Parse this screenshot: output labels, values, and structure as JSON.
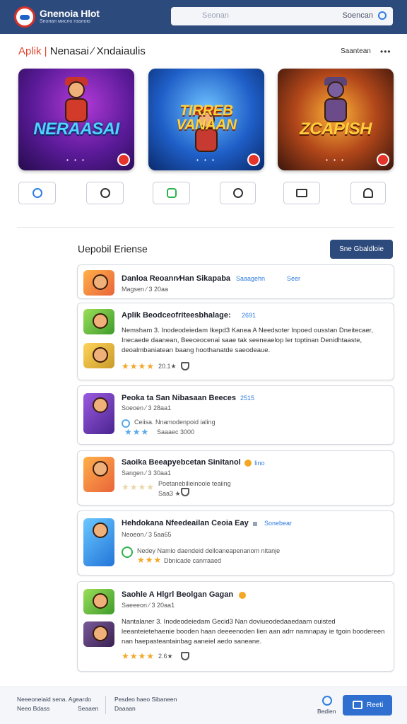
{
  "header": {
    "logo_text": "Gnenoia Hlot",
    "logo_sub": "Ѕнонан мисло гоалою",
    "search_placeholder": "Seonan",
    "search_label": "Soencan"
  },
  "featured": {
    "title_highlight": "Aplik |",
    "title_rest": " Nenasai ⁄ Xndaiaulis",
    "link": "Saantean",
    "games": [
      {
        "title": "NERAASAI",
        "dots": "• • •"
      },
      {
        "title": "TIRREB VANAAN",
        "dots": "• • •"
      },
      {
        "title": "ZCAPISH",
        "dots": "• • •"
      }
    ]
  },
  "list": {
    "title": "Uepobil Eriense",
    "see_all": "Sne Gbaldloie",
    "items": [
      {
        "title": "Danloa Reoann⁄Han Sikapaba",
        "tag": "Saaagehn",
        "tag2": "Seer",
        "sub": "Magsen ⁄ 3 20aa"
      },
      {
        "title": "Aplik Beodceofriteesbhalage:",
        "tag": "2691",
        "desc": "Nemsham 3. Inodeodeiedam Ikepd3 Kanea A Needsoter Inpoed ousstan Dneitecaer, Inecaede daanean, Beeceocenai saae tak seeneaelop ler toptinan Denidhtaaste, deoalmbaniatearı baang hoothanatde saeodeaue.",
        "rating": "20.1★"
      },
      {
        "title": "Peoka ta San Nibasaan Beeces",
        "tag": "2515",
        "sub": "Soeoen ⁄ 3 28aa1",
        "meta1": "Ceiisa. Nnamodenpoid ialing",
        "meta2": "Saaaec 3000"
      },
      {
        "title": "Saoika Beeapyebcetan Sinitanol",
        "tag": "Iino",
        "sub": "Sangen ⁄ 3 30aa1",
        "meta1": "Poetanebilieinoole teaiing",
        "meta2": "Saa3 ★"
      },
      {
        "title": "Hehdokana Nfeedeailan Ceoia Eay",
        "tag": "Sonebear",
        "sub": "Neoeon ⁄ 3 5aa65",
        "meta1": "Nedey Namio daendeid delloaneapenanom nitanje",
        "meta2": "Dbnicade canrraaed"
      },
      {
        "title": "Saohle A Hlgrl Beolgan Gagan",
        "sub": "Saeeeon ⁄ 3 20aa1",
        "desc": "Nantalaner 3. Inodeodeiedam Gecid3 Nan doviueodedaaedaam ouisted leeanteietehaenie booden haan deeeenoden lien aan adrr namnapay ie tgoin boodereen nan haepasteantainbag aaneiel aedo saneane.",
        "rating": "2.6★"
      }
    ]
  },
  "footer": {
    "col1_line1": "Neeeoneiaid sena. Ageardo",
    "col1_line2": "Neeo Bdass",
    "col1_line2b": "Seaaen",
    "col2_line1": "Pesdeo haeo Sibaneen",
    "col2_line2": "Daaaan",
    "help_label": "Bedien",
    "print_label": "Reeti"
  }
}
